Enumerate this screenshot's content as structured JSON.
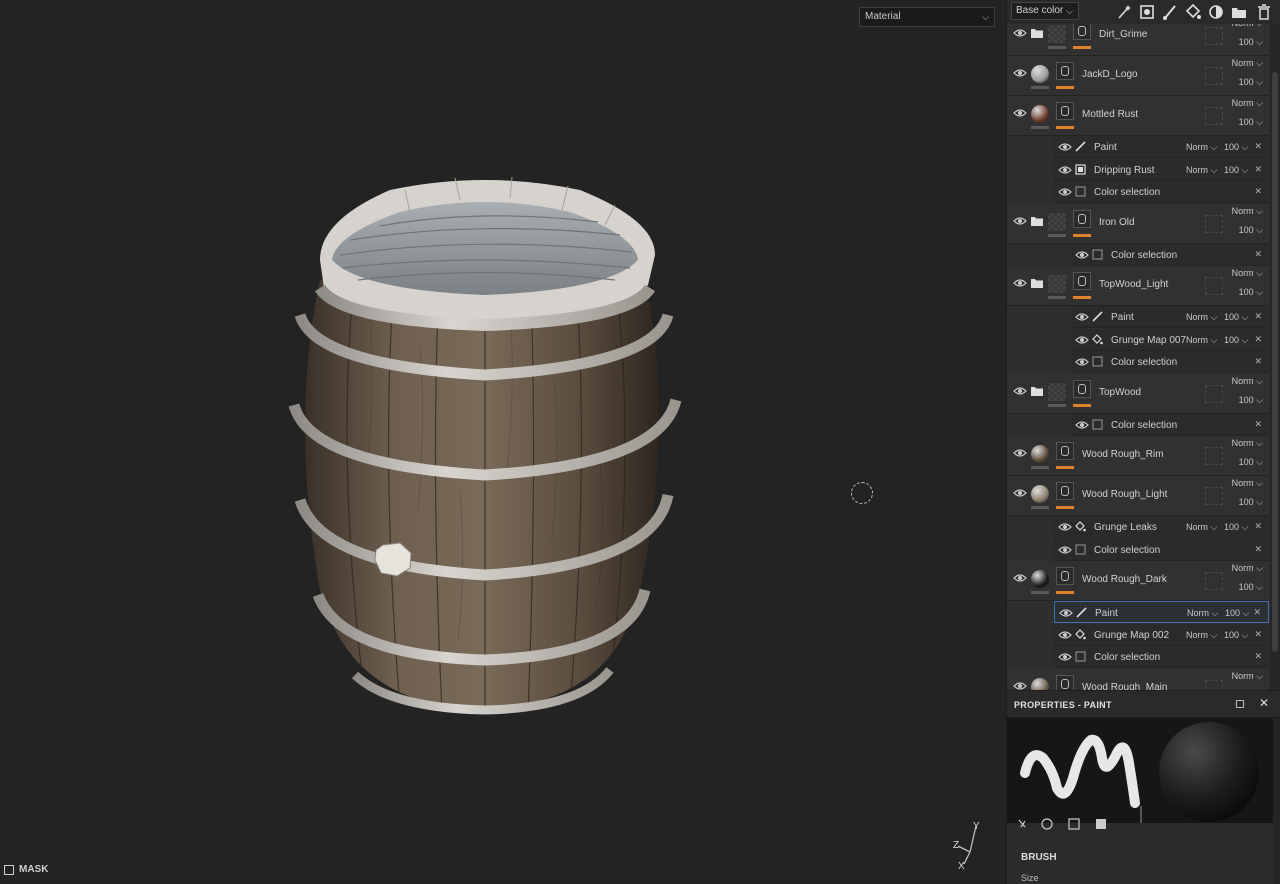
{
  "viewport": {
    "material_select": "Material",
    "mask_label": "MASK",
    "gizmo_axes": {
      "y": "Y",
      "z": "Z",
      "x": "X"
    }
  },
  "layers_panel": {
    "channel_select": "Base color",
    "toolbar_icons": [
      "magic-wand-icon",
      "fill-mask-icon",
      "paint-brush-icon",
      "fill-bucket-icon",
      "smart-material-icon",
      "folder-icon",
      "trash-icon"
    ],
    "layers": [
      {
        "name": "Dirt_Grime",
        "type": "folder",
        "blend": "Norm",
        "opacity": "100",
        "effects": []
      },
      {
        "name": "JackD_Logo",
        "type": "fill",
        "thumb_color": "#9a9a9a",
        "blend": "Norm",
        "opacity": "100",
        "effects": []
      },
      {
        "name": "Mottled Rust",
        "type": "fill",
        "thumb_color": "#6b3a28",
        "blend": "Norm",
        "opacity": "100",
        "effects": [
          {
            "name": "Paint",
            "icon": "brush-icon",
            "blend": "Norm",
            "opacity": "100"
          },
          {
            "name": "Dripping Rust",
            "icon": "generator-icon",
            "blend": "Norm",
            "opacity": "100"
          },
          {
            "name": "Color selection",
            "icon": "color-selection-icon",
            "blend": "",
            "opacity": ""
          }
        ]
      },
      {
        "name": "Iron Old",
        "type": "folder",
        "blend": "Norm",
        "opacity": "100",
        "effects": [
          {
            "name": "Color selection",
            "icon": "color-selection-icon",
            "blend": "",
            "opacity": ""
          }
        ]
      },
      {
        "name": "TopWood_Light",
        "type": "folder",
        "blend": "Norm",
        "opacity": "100",
        "effects": [
          {
            "name": "Paint",
            "icon": "brush-icon",
            "blend": "Norm",
            "opacity": "100"
          },
          {
            "name": "Grunge Map 007",
            "icon": "fill-icon",
            "blend": "Norm",
            "opacity": "100"
          },
          {
            "name": "Color selection",
            "icon": "color-selection-icon",
            "blend": "",
            "opacity": ""
          }
        ]
      },
      {
        "name": "TopWood",
        "type": "folder",
        "blend": "Norm",
        "opacity": "100",
        "effects": [
          {
            "name": "Color selection",
            "icon": "color-selection-icon",
            "blend": "",
            "opacity": ""
          }
        ]
      },
      {
        "name": "Wood Rough_Rim",
        "type": "fill",
        "thumb_color": "#5a4a38",
        "blend": "Norm",
        "opacity": "100",
        "effects": []
      },
      {
        "name": "Wood Rough_Light",
        "type": "fill",
        "thumb_color": "#8a7e6c",
        "blend": "Norm",
        "opacity": "100",
        "effects": [
          {
            "name": "Grunge Leaks",
            "icon": "fill-icon",
            "blend": "Norm",
            "opacity": "100"
          },
          {
            "name": "Color selection",
            "icon": "color-selection-icon",
            "blend": "",
            "opacity": ""
          }
        ]
      },
      {
        "name": "Wood Rough_Dark",
        "type": "fill",
        "thumb_color": "#1c1c1c",
        "blend": "Norm",
        "opacity": "100",
        "effects": [
          {
            "name": "Paint",
            "icon": "brush-icon",
            "blend": "Norm",
            "opacity": "100",
            "selected": true
          },
          {
            "name": "Grunge Map 002",
            "icon": "fill-icon",
            "blend": "Norm",
            "opacity": "100"
          },
          {
            "name": "Color selection",
            "icon": "color-selection-icon",
            "blend": "",
            "opacity": ""
          }
        ]
      },
      {
        "name": "Wood Rough_Main",
        "type": "fill",
        "thumb_color": "#6a5a48",
        "blend": "Norm",
        "opacity": "",
        "effects": []
      }
    ]
  },
  "properties": {
    "title": "PROPERTIES - PAINT",
    "section": "BRUSH",
    "first_param": "Size"
  },
  "colors": {
    "accent_orange": "#e0822b",
    "selection_blue": "#3c6fb6"
  }
}
